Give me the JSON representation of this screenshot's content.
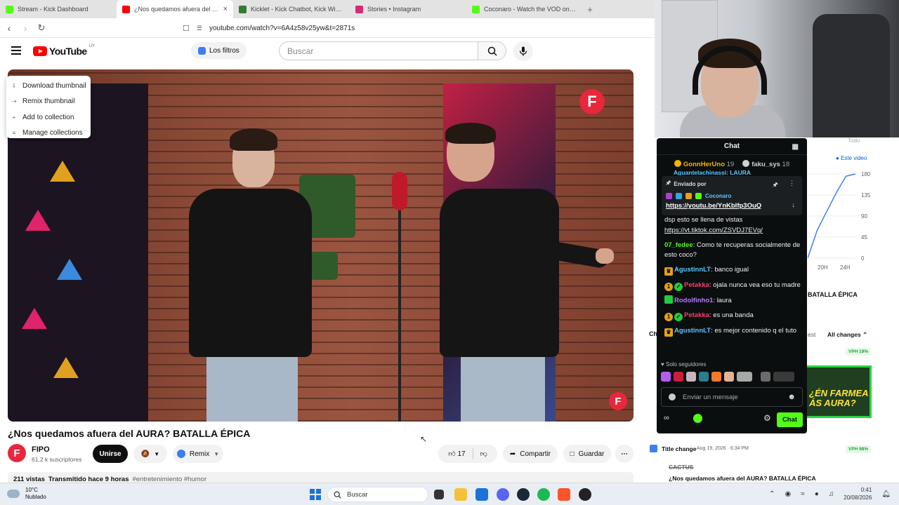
{
  "browser": {
    "tabs": [
      {
        "title": "Stream - Kick Dashboard",
        "color": "#53fc18",
        "active": false
      },
      {
        "title": "¿Nos quedamos afuera del AURA?",
        "color": "#ff0000",
        "active": true
      },
      {
        "title": "Kicklet - Kick Chatbot, Kick Widgets",
        "color": "#2e7d32",
        "active": false
      },
      {
        "title": "Stories • Instagram",
        "color": "#d62976",
        "active": false
      },
      {
        "title": "Coconaro - Watch the VOD on Kick",
        "color": "#53fc18",
        "active": false
      }
    ],
    "new_tab": "+",
    "url": "youtube.com/watch?v=6A4z58v25yw&t=2871s"
  },
  "youtube": {
    "logo": "YouTube",
    "country": "UY",
    "filters_label": "Los filtros",
    "search_placeholder": "Buscar"
  },
  "context_menu": {
    "items": [
      {
        "label": "Download thumbnail",
        "icon": "download-icon"
      },
      {
        "label": "Remix thumbnail",
        "icon": "remix-icon"
      },
      {
        "label": "Add to collection",
        "icon": "add-icon"
      },
      {
        "label": "Manage collections",
        "icon": "collections-icon"
      }
    ]
  },
  "video": {
    "overlay_logo": "F",
    "title": "¿Nos quedamos afuera del AURA? BATALLA ÉPICA",
    "channel": "FIPO",
    "channel_initial": "F",
    "subscribers": "61.2 k suscriptores",
    "join_label": "Unirse",
    "remix_label": "Remix",
    "likes": "17",
    "share_label": "Compartir",
    "save_label": "Guardar",
    "views": "211 vistas",
    "streamed": "Transmitido hace 9 horas",
    "hashtags": "#entretenimiento #humor"
  },
  "right_panel": {
    "period_all": "Todo",
    "legend": "Este video",
    "y_ticks": [
      "180",
      "135",
      "90",
      "45",
      "0"
    ],
    "x_ticks": [
      "20H",
      "24H"
    ],
    "chart_data": {
      "type": "line",
      "series": [
        {
          "name": "Este video",
          "values": [
            0,
            60,
            100,
            140,
            175,
            180
          ]
        }
      ],
      "ylim": [
        0,
        180
      ],
      "x_ticks": [
        "20H",
        "24H"
      ]
    },
    "video_title_partial": "BATALLA ÉPICA",
    "section_partial": "Ch",
    "latest_partial": "est",
    "all_changes": "All changes",
    "vph_top": "VPH 19%",
    "thumb_text": "¿ÉN FARMEA\nÁS AURA?",
    "change_label": "Title change",
    "change_date": "Aug 19, 2026 · 6:34 PM",
    "vph_bottom": "VPH 98%",
    "old_title": "CACTUS",
    "new_title": "¿Nos quedamos afuera del AURA? BATALLA ÉPICA"
  },
  "chat": {
    "title": "Chat",
    "top_users": [
      {
        "name": "GonnHerUno",
        "count": "19",
        "color": "#f5b400"
      },
      {
        "name": "faku_sys",
        "count": "18",
        "color": "#d0d0d0"
      }
    ],
    "partial_line": "Aguantelachinassi: LAURA",
    "pinned": {
      "label": "Enviado por",
      "user": "Coconaro",
      "link": "https://youtu.be/YnKblfp3OuQ"
    },
    "messages": [
      {
        "user": "",
        "color": "#efeff1",
        "text": "dsp esto se llena de vistas",
        "link": "https://vt.tiktok.com/ZSVDJ7EVq/",
        "badges": []
      },
      {
        "user": "07_fedee",
        "color": "#53fc18",
        "text": "Como te recuperas socialmente de esto coco?",
        "badges": []
      },
      {
        "user": "AgustinnLT",
        "color": "#5cc8ff",
        "text": "banco igual",
        "badges": [
          "crown"
        ]
      },
      {
        "user": "Petakka",
        "color": "#ff3d6e",
        "text": "ojala nunca vea eso tu madre",
        "badges": [
          "sub",
          "verified"
        ]
      },
      {
        "user": "Rodolfinho1",
        "color": "#b779ff",
        "text": "laura",
        "badges": [
          "green"
        ]
      },
      {
        "user": "Petakka",
        "color": "#ff3d6e",
        "text": "es una banda",
        "badges": [
          "sub",
          "verified"
        ]
      },
      {
        "user": "AgustinnLT",
        "color": "#5cc8ff",
        "text": "es mejor contenido q el tuto",
        "badges": [
          "crown"
        ]
      }
    ],
    "followers_only": "Solo seguidores",
    "input_placeholder": "Enviar un mensaje",
    "chat_button": "Chat"
  },
  "taskbar": {
    "temp": "10°C",
    "condition": "Nublado",
    "search": "Buscar",
    "time": "0:41",
    "date": "20/08/2026"
  }
}
